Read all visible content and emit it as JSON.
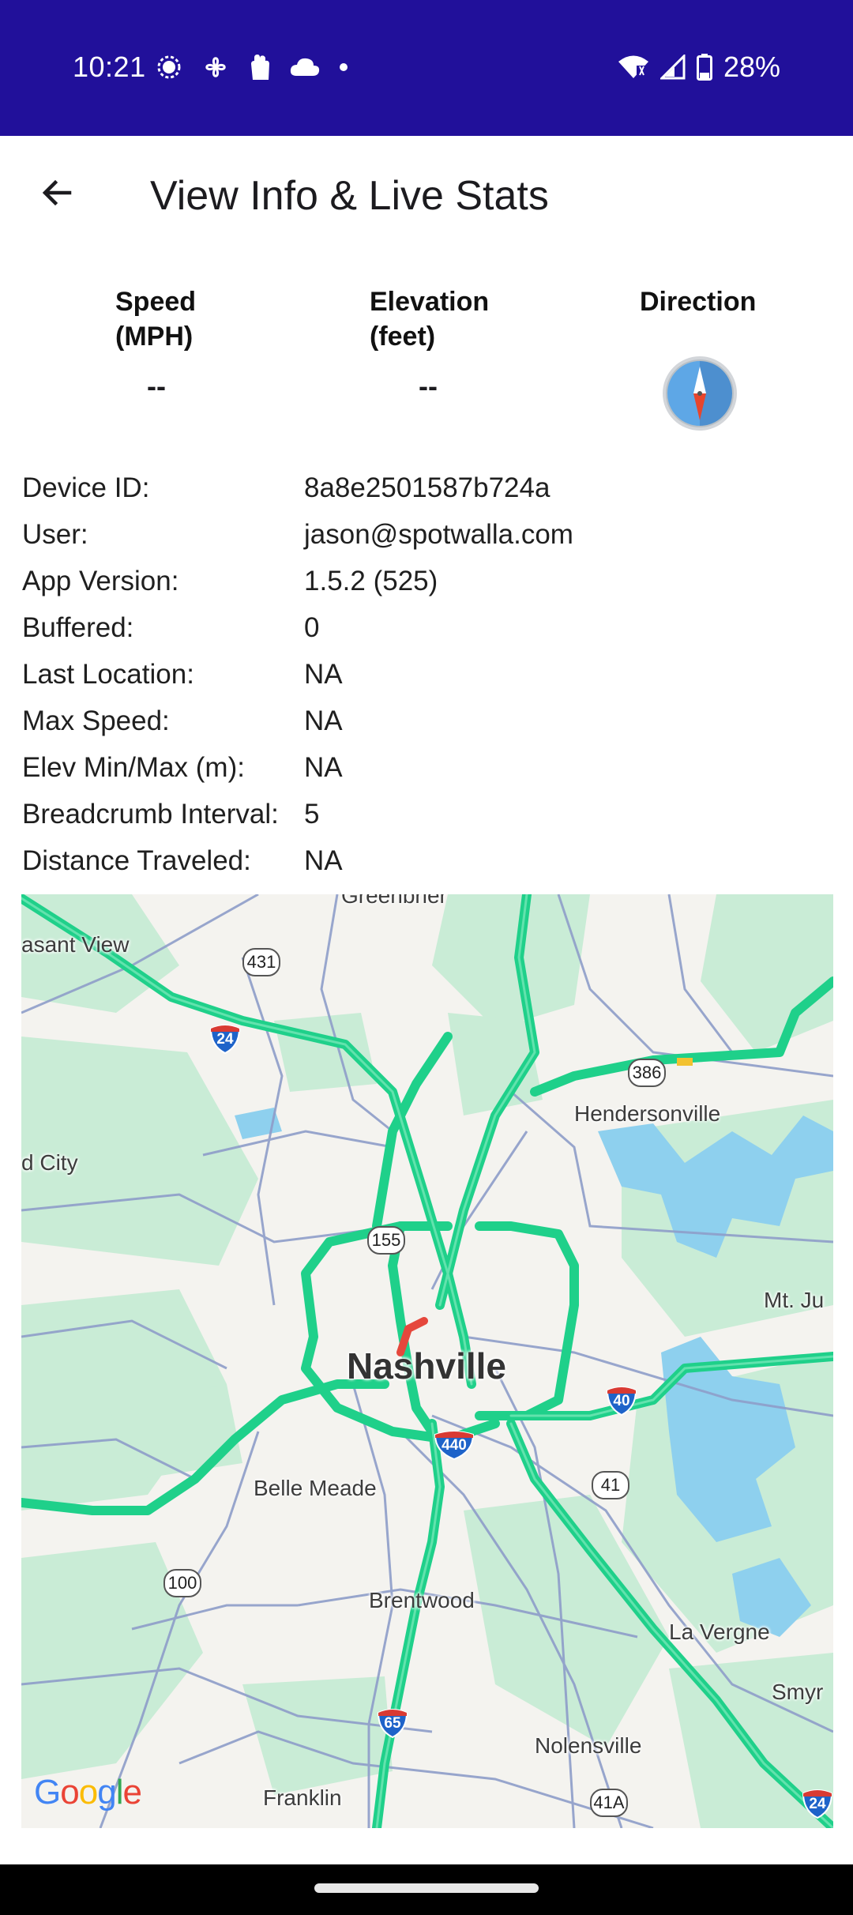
{
  "status_bar": {
    "time": "10:21",
    "battery_percent": "28%",
    "left_icons": [
      "signal-app-icon",
      "fan-icon",
      "hand-icon",
      "cloud-icon",
      "dot-icon"
    ],
    "right_icons": [
      "wifi-icon",
      "cell-signal-icon",
      "battery-icon"
    ]
  },
  "app_bar": {
    "title": "View Info & Live Stats",
    "back_icon": "arrow-back-icon"
  },
  "stats": {
    "speed": {
      "label": "Speed\n(MPH)",
      "value": "--"
    },
    "elevation": {
      "label": "Elevation\n(feet)",
      "value": "--"
    },
    "direction": {
      "label": "Direction",
      "icon": "compass-icon"
    }
  },
  "info": [
    {
      "label": "Device ID:",
      "value": "8a8e2501587b724a"
    },
    {
      "label": "User:",
      "value": "jason@spotwalla.com"
    },
    {
      "label": "App Version:",
      "value": "1.5.2 (525)"
    },
    {
      "label": "Buffered:",
      "value": "0"
    },
    {
      "label": "Last Location:",
      "value": "NA"
    },
    {
      "label": "Max Speed:",
      "value": "NA"
    },
    {
      "label": "Elev Min/Max (m):",
      "value": "NA"
    },
    {
      "label": "Breadcrumb Interval:",
      "value": "5"
    },
    {
      "label": "Distance Traveled:",
      "value": "NA"
    }
  ],
  "map": {
    "city": "Nashville",
    "places": {
      "greenbrier": "Greenbrier",
      "pleasant_view": "asant View",
      "hendersonville": "Hendersonville",
      "ridgetop": "d City",
      "mt_juliet": "Mt. Ju",
      "belle_meade": "Belle Meade",
      "brentwood": "Brentwood",
      "la_vergne": "La Vergne",
      "smyrna": "Smyr",
      "nolensville": "Nolensville",
      "franklin": "Franklin"
    },
    "routes": {
      "us431": "431",
      "i24_north": "24",
      "sr386": "386",
      "sr155": "155",
      "i40": "40",
      "i440": "440",
      "us41": "41",
      "sr100": "100",
      "i65": "65",
      "us41a": "41A",
      "i24_south": "24"
    },
    "attribution": "Google",
    "colors": {
      "traffic_green": "#1fd08a",
      "traffic_red": "#e5473c",
      "water": "#8ed0ee",
      "park": "#c9ecd6",
      "road": "#8e9dc9"
    }
  },
  "colors": {
    "status_bar": "#21109a"
  }
}
